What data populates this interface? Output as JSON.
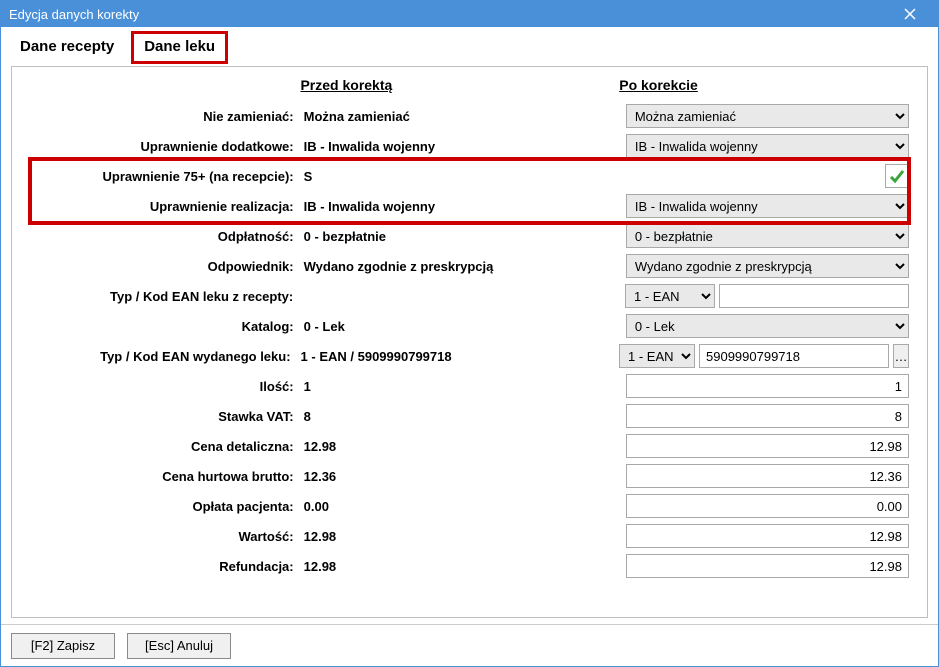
{
  "window": {
    "title": "Edycja danych korekty"
  },
  "tabs": {
    "prescription": "Dane recepty",
    "drug": "Dane leku"
  },
  "headers": {
    "before": "Przed korektą",
    "after": "Po korekcie"
  },
  "labels": {
    "no_change": "Nie zamieniać:",
    "extra_right": "Uprawnienie dodatkowe:",
    "right_75": "Uprawnienie 75+ (na recepcie):",
    "right_real": "Uprawnienie realizacja:",
    "payment": "Odpłatność:",
    "equivalent": "Odpowiednik:",
    "ean_recipe": "Typ / Kod EAN leku z recepty:",
    "catalog": "Katalog:",
    "ean_issued": "Typ / Kod EAN wydanego leku:",
    "qty": "Ilość:",
    "vat": "Stawka VAT:",
    "retail": "Cena detaliczna:",
    "wholesale": "Cena hurtowa brutto:",
    "patient_fee": "Opłata pacjenta:",
    "value": "Wartość:",
    "refund": "Refundacja:"
  },
  "before": {
    "no_change": "Można zamieniać",
    "extra_right": "IB - Inwalida wojenny",
    "right_75": "S",
    "right_real": "IB - Inwalida wojenny",
    "payment": "0 - bezpłatnie",
    "equivalent": "Wydano zgodnie z preskrypcją",
    "ean_recipe": "",
    "catalog": "0 - Lek",
    "ean_issued": "1 - EAN / 5909990799718",
    "qty": "1",
    "vat": "8",
    "retail": "12.98",
    "wholesale": "12.36",
    "patient_fee": "0.00",
    "value": "12.98",
    "refund": "12.98"
  },
  "after": {
    "no_change": "Można zamieniać",
    "extra_right": "IB - Inwalida wojenny",
    "right_75_checked": "checked",
    "right_real": "IB - Inwalida wojenny",
    "payment": "0 - bezpłatnie",
    "equivalent": "Wydano zgodnie z preskrypcją",
    "ean_recipe_type": "1 - EAN",
    "ean_recipe_code": "",
    "catalog": "0 - Lek",
    "ean_issued_type": "1 - EAN",
    "ean_issued_code": "5909990799718",
    "qty": "1",
    "vat": "8",
    "retail": "12.98",
    "wholesale": "12.36",
    "patient_fee": "0.00",
    "value": "12.98",
    "refund": "12.98"
  },
  "buttons": {
    "save": "[F2] Zapisz",
    "cancel": "[Esc] Anuluj",
    "ellipsis": "…"
  }
}
